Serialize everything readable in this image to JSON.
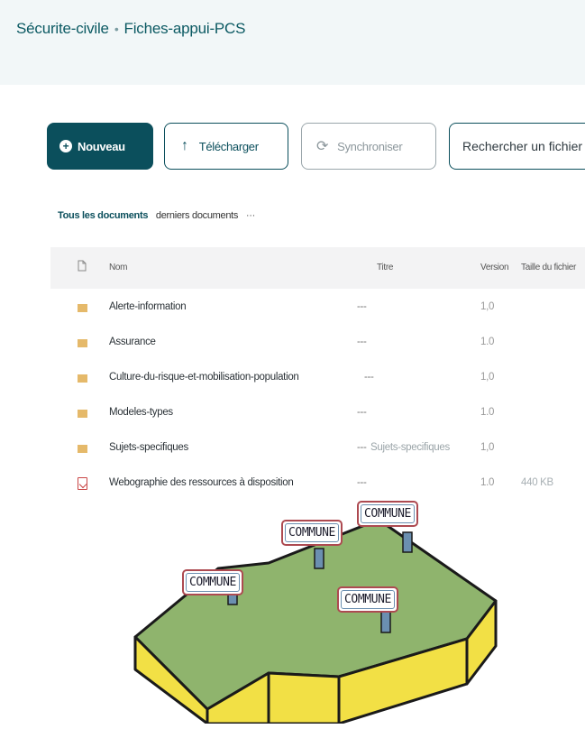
{
  "breadcrumb": {
    "site": "Sécurite-civile",
    "separator": "•",
    "library": "Fiches-appui-PCS"
  },
  "toolbar": {
    "new_label": "Nouveau",
    "upload_label": "Télécharger",
    "sync_label": "Synchroniser",
    "search_placeholder": "Rechercher un fichier"
  },
  "views": {
    "all": "Tous les documents",
    "recent": "derniers documents",
    "more": "···"
  },
  "table": {
    "columns": {
      "name": "Nom",
      "title": "Titre",
      "version": "Version",
      "size": "Taille du fichier"
    },
    "rows": [
      {
        "type": "folder",
        "name": "Alerte-information",
        "dash": "---",
        "title": "",
        "version": "1,0",
        "size": ""
      },
      {
        "type": "folder",
        "name": "Assurance",
        "dash": "---",
        "title": "",
        "version": "1.0",
        "size": ""
      },
      {
        "type": "folder",
        "name": "Culture-du-risque-et-mobilisation-population",
        "dash": "---",
        "title": "",
        "version": "1,0",
        "size": ""
      },
      {
        "type": "folder",
        "name": "Modeles-types",
        "dash": "---",
        "title": "",
        "version": "1.0",
        "size": ""
      },
      {
        "type": "folder",
        "name": "Sujets-specifiques",
        "dash": "---",
        "title": "Sujets-specifiques",
        "version": "1,0",
        "size": ""
      },
      {
        "type": "pdf",
        "name": "Webographie des ressources à disposition",
        "dash": "---",
        "title": "",
        "version": "1.0",
        "size": "440 KB"
      }
    ]
  },
  "illustration": {
    "signs": [
      "COMMUNE",
      "COMMUNE",
      "COMMUNE",
      "COMMUNE"
    ],
    "colors": {
      "land": "#8fb46d",
      "edge": "#f2e045",
      "outline": "#1a1a1a",
      "sign_border": "#ad4a51",
      "post": "#6b8fb0"
    }
  },
  "colors": {
    "accent": "#0b4f5c",
    "topbar": "#f2f7f8",
    "header_row": "#f3f3f4"
  }
}
